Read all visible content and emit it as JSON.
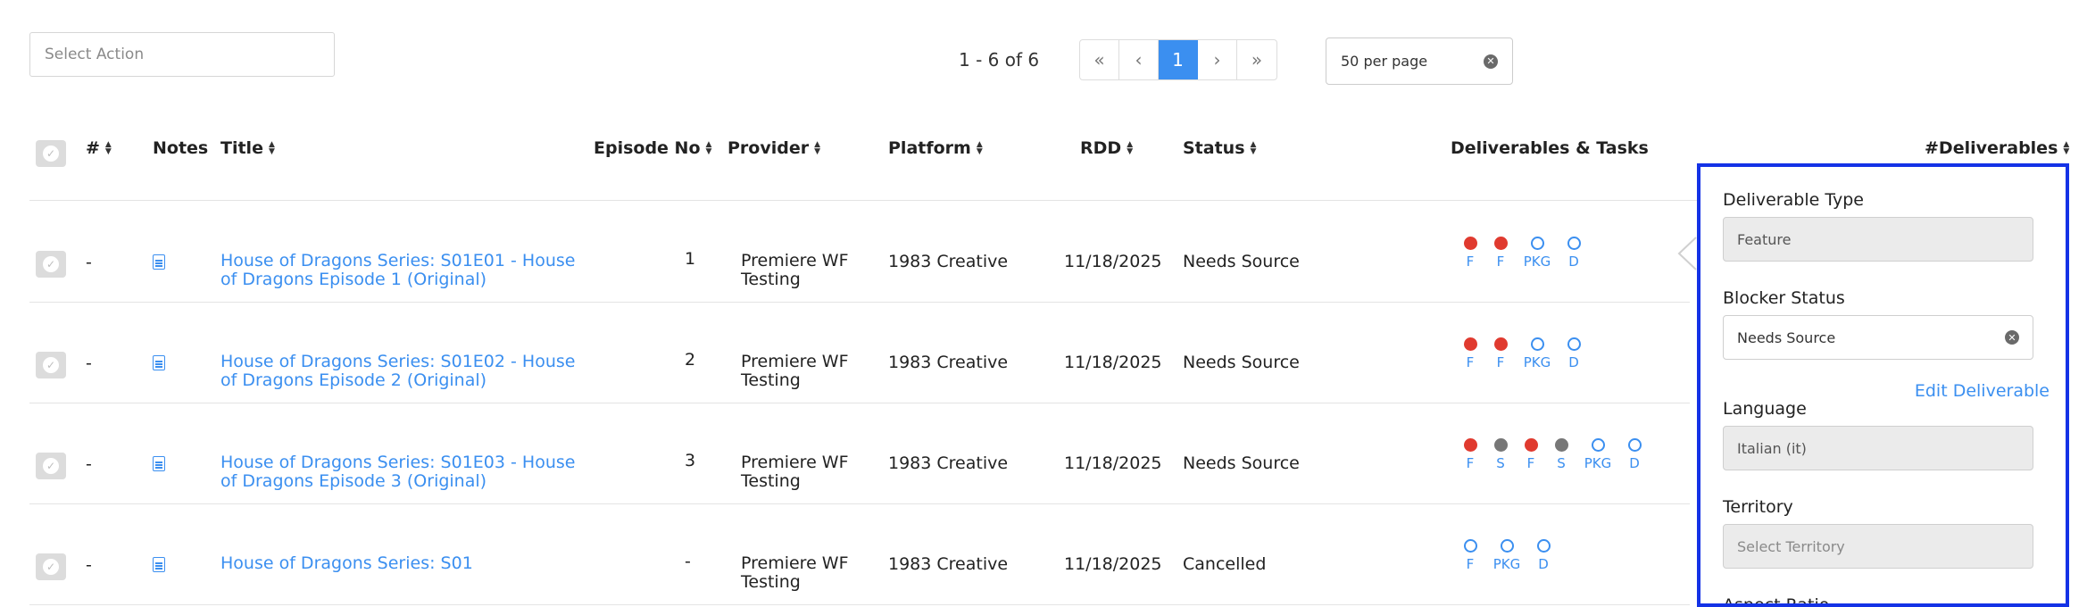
{
  "toolbar": {
    "select_action_placeholder": "Select Action",
    "page_count": "1 - 6 of 6",
    "pager": {
      "first": "«",
      "prev": "‹",
      "current": "1",
      "next": "›",
      "last": "»"
    },
    "per_page": "50 per page"
  },
  "columns": {
    "num": "#",
    "notes": "Notes",
    "title": "Title",
    "episode_no": "Episode No",
    "provider": "Provider",
    "platform": "Platform",
    "rdd": "RDD",
    "status": "Status",
    "deliverables_tasks": "Deliverables & Tasks",
    "deliverables_count": "#Deliverables"
  },
  "rows": [
    {
      "num": "-",
      "title_line1": "House of Dragons Series: S01E01 - House",
      "title_line2": "of Dragons Episode 1 (Original)",
      "episode_no": "1",
      "provider_line1": "Premiere WF",
      "provider_line2": "Testing",
      "platform": "1983 Creative",
      "rdd": "11/18/2025",
      "status": "Needs Source",
      "dots": [
        {
          "state": "red",
          "label": "F"
        },
        {
          "state": "red",
          "label": "F"
        },
        {
          "state": "empty",
          "label": "PKG"
        },
        {
          "state": "empty",
          "label": "D"
        }
      ]
    },
    {
      "num": "-",
      "title_line1": "House of Dragons Series: S01E02 - House",
      "title_line2": "of Dragons Episode 2 (Original)",
      "episode_no": "2",
      "provider_line1": "Premiere WF",
      "provider_line2": "Testing",
      "platform": "1983 Creative",
      "rdd": "11/18/2025",
      "status": "Needs Source",
      "dots": [
        {
          "state": "red",
          "label": "F"
        },
        {
          "state": "red",
          "label": "F"
        },
        {
          "state": "empty",
          "label": "PKG"
        },
        {
          "state": "empty",
          "label": "D"
        }
      ]
    },
    {
      "num": "-",
      "title_line1": "House of Dragons Series: S01E03 - House",
      "title_line2": "of Dragons Episode 3 (Original)",
      "episode_no": "3",
      "provider_line1": "Premiere WF",
      "provider_line2": "Testing",
      "platform": "1983 Creative",
      "rdd": "11/18/2025",
      "status": "Needs Source",
      "dots": [
        {
          "state": "red",
          "label": "F"
        },
        {
          "state": "gray",
          "label": "S"
        },
        {
          "state": "red",
          "label": "F"
        },
        {
          "state": "gray",
          "label": "S"
        },
        {
          "state": "empty",
          "label": "PKG"
        },
        {
          "state": "empty",
          "label": "D"
        }
      ]
    },
    {
      "num": "-",
      "title_line1": "House of Dragons Series: S01",
      "title_line2": "",
      "episode_no": "-",
      "provider_line1": "Premiere WF",
      "provider_line2": "Testing",
      "platform": "1983 Creative",
      "rdd": "11/18/2025",
      "status": "Cancelled",
      "dots": [
        {
          "state": "empty",
          "label": "F"
        },
        {
          "state": "empty",
          "label": "PKG"
        },
        {
          "state": "empty",
          "label": "D"
        }
      ]
    }
  ],
  "panel": {
    "deliverable_type_label": "Deliverable Type",
    "deliverable_type_value": "Feature",
    "blocker_status_label": "Blocker Status",
    "blocker_status_value": "Needs Source",
    "edit_deliverable": "Edit Deliverable",
    "language_label": "Language",
    "language_value": "Italian (it)",
    "territory_label": "Territory",
    "territory_placeholder": "Select Territory",
    "next_label_partial": "Aspect Ratio"
  },
  "colors": {
    "accent": "#3b8ff0",
    "red": "#e03a2f",
    "gray": "#777777",
    "panel_border": "#1432e6"
  }
}
